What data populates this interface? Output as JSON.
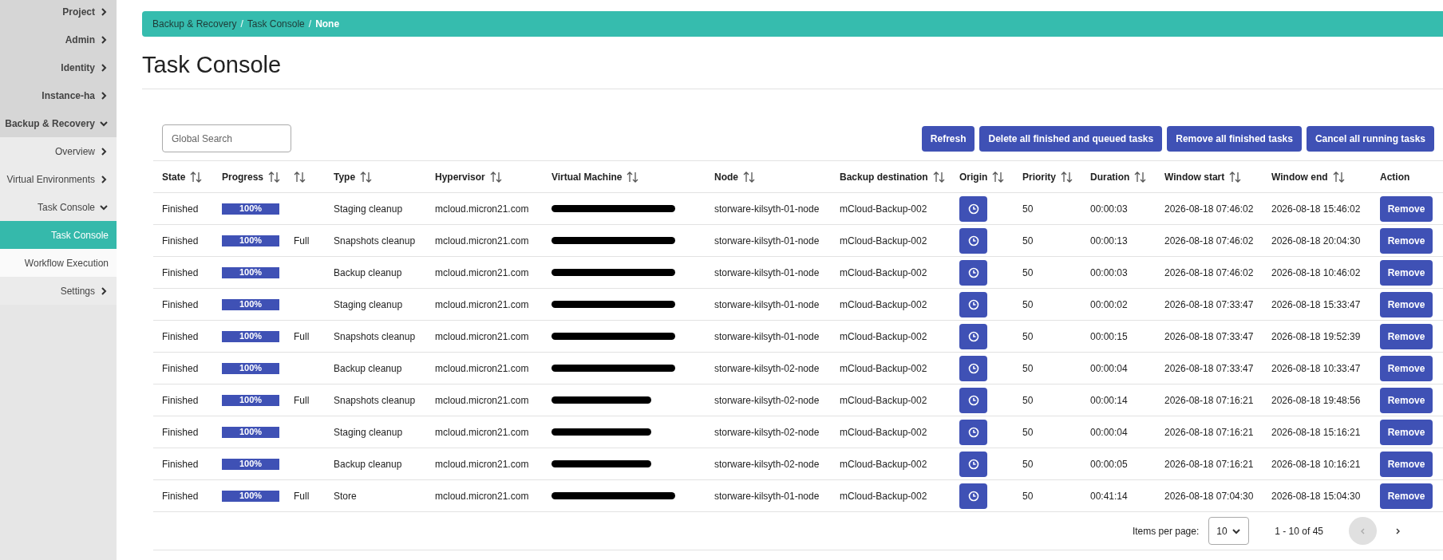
{
  "sidebar": {
    "items": [
      {
        "label": "Project",
        "expanded": false
      },
      {
        "label": "Admin",
        "expanded": false
      },
      {
        "label": "Identity",
        "expanded": false
      },
      {
        "label": "Instance-ha",
        "expanded": false
      },
      {
        "label": "Backup & Recovery",
        "expanded": true,
        "children": [
          {
            "label": "Overview",
            "expanded": false
          },
          {
            "label": "Virtual Environments",
            "expanded": false
          },
          {
            "label": "Task Console",
            "expanded": true,
            "children": [
              {
                "label": "Task Console",
                "selected": true
              },
              {
                "label": "Workflow Execution",
                "selected": false
              }
            ]
          },
          {
            "label": "Settings",
            "expanded": false
          }
        ]
      }
    ]
  },
  "breadcrumb": {
    "separator": "/",
    "items": [
      "Backup & Recovery",
      "Task Console",
      "None"
    ]
  },
  "title": "Task Console",
  "search": {
    "placeholder": "Global Search"
  },
  "buttons": [
    "Refresh",
    "Delete all finished and queued tasks",
    "Remove all finished tasks",
    "Cancel all running tasks"
  ],
  "table": {
    "columns": [
      {
        "label": "State",
        "sortable": true
      },
      {
        "label": "Progress",
        "sortable": true
      },
      {
        "sortable": true
      },
      {
        "label": "Type",
        "sortable": true
      },
      {
        "label": "Hypervisor",
        "sortable": true
      },
      {
        "label": "Virtual Machine",
        "sortable": true
      },
      {
        "label": "Node",
        "sortable": true
      },
      {
        "label": "Backup destination",
        "sortable": true
      },
      {
        "label": "Origin",
        "sortable": true
      },
      {
        "label": "Priority",
        "sortable": true
      },
      {
        "label": "Duration",
        "sortable": true
      },
      {
        "label": "Window start",
        "sortable": true
      },
      {
        "label": "Window end",
        "sortable": true
      },
      {
        "label": "Action",
        "sortable": false
      }
    ],
    "rows": [
      {
        "state": "Finished",
        "progress": {
          "level": 1,
          "label": "100%"
        },
        "mode": "",
        "type": "Staging cleanup",
        "hypervisor": "mcloud.micron21.com",
        "vm_redacted": true,
        "node": "storware-kilsyth-01-node",
        "destination": "mCloud-Backup-002",
        "priority": "50",
        "duration": "00:00:03",
        "window_start": "2026-08-18 07:46:02",
        "window_end": "2026-08-18 15:46:02",
        "action": "Remove"
      },
      {
        "state": "Finished",
        "progress": {
          "level": 1,
          "label": "100%"
        },
        "mode": "Full",
        "type": "Snapshots cleanup",
        "hypervisor": "mcloud.micron21.com",
        "vm_redacted": true,
        "node": "storware-kilsyth-01-node",
        "destination": "mCloud-Backup-002",
        "priority": "50",
        "duration": "00:00:13",
        "window_start": "2026-08-18 07:46:02",
        "window_end": "2026-08-18 20:04:30",
        "action": "Remove"
      },
      {
        "state": "Finished",
        "progress": {
          "level": 1,
          "label": "100%"
        },
        "mode": "",
        "type": "Backup cleanup",
        "hypervisor": "mcloud.micron21.com",
        "vm_redacted": true,
        "node": "storware-kilsyth-01-node",
        "destination": "mCloud-Backup-002",
        "priority": "50",
        "duration": "00:00:03",
        "window_start": "2026-08-18 07:46:02",
        "window_end": "2026-08-18 10:46:02",
        "action": "Remove"
      },
      {
        "state": "Finished",
        "progress": {
          "level": 1,
          "label": "100%"
        },
        "mode": "",
        "type": "Staging cleanup",
        "hypervisor": "mcloud.micron21.com",
        "vm_redacted": true,
        "node": "storware-kilsyth-01-node",
        "destination": "mCloud-Backup-002",
        "priority": "50",
        "duration": "00:00:02",
        "window_start": "2026-08-18 07:33:47",
        "window_end": "2026-08-18 15:33:47",
        "action": "Remove"
      },
      {
        "state": "Finished",
        "progress": {
          "level": 1,
          "label": "100%"
        },
        "mode": "Full",
        "type": "Snapshots cleanup",
        "hypervisor": "mcloud.micron21.com",
        "vm_redacted": true,
        "node": "storware-kilsyth-01-node",
        "destination": "mCloud-Backup-002",
        "priority": "50",
        "duration": "00:00:15",
        "window_start": "2026-08-18 07:33:47",
        "window_end": "2026-08-18 19:52:39",
        "action": "Remove"
      },
      {
        "state": "Finished",
        "progress": {
          "level": 1,
          "label": "100%"
        },
        "mode": "",
        "type": "Backup cleanup",
        "hypervisor": "mcloud.micron21.com",
        "vm_redacted": true,
        "node": "storware-kilsyth-02-node",
        "destination": "mCloud-Backup-002",
        "priority": "50",
        "duration": "00:00:04",
        "window_start": "2026-08-18 07:33:47",
        "window_end": "2026-08-18 10:33:47",
        "action": "Remove"
      },
      {
        "state": "Finished",
        "progress": {
          "level": 1,
          "label": "100%"
        },
        "mode": "Full",
        "type": "Snapshots cleanup",
        "hypervisor": "mcloud.micron21.com",
        "vm_redacted": true,
        "node": "storware-kilsyth-02-node",
        "destination": "mCloud-Backup-002",
        "priority": "50",
        "duration": "00:00:14",
        "window_start": "2026-08-18 07:16:21",
        "window_end": "2026-08-18 19:48:56",
        "action": "Remove"
      },
      {
        "state": "Finished",
        "progress": {
          "level": 1,
          "label": "100%"
        },
        "mode": "",
        "type": "Staging cleanup",
        "hypervisor": "mcloud.micron21.com",
        "vm_redacted": true,
        "node": "storware-kilsyth-02-node",
        "destination": "mCloud-Backup-002",
        "priority": "50",
        "duration": "00:00:04",
        "window_start": "2026-08-18 07:16:21",
        "window_end": "2026-08-18 15:16:21",
        "action": "Remove"
      },
      {
        "state": "Finished",
        "progress": {
          "level": 1,
          "label": "100%"
        },
        "mode": "",
        "type": "Backup cleanup",
        "hypervisor": "mcloud.micron21.com",
        "vm_redacted": true,
        "node": "storware-kilsyth-02-node",
        "destination": "mCloud-Backup-002",
        "priority": "50",
        "duration": "00:00:05",
        "window_start": "2026-08-18 07:16:21",
        "window_end": "2026-08-18 10:16:21",
        "action": "Remove"
      },
      {
        "state": "Finished",
        "progress": {
          "level": 1,
          "label": "100%"
        },
        "mode": "Full",
        "type": "Store",
        "hypervisor": "mcloud.micron21.com",
        "vm_redacted": true,
        "node": "storware-kilsyth-01-node",
        "destination": "mCloud-Backup-002",
        "priority": "50",
        "duration": "00:41:14",
        "window_start": "2026-08-18 07:04:30",
        "window_end": "2026-08-18 15:04:30",
        "action": "Remove"
      }
    ]
  },
  "pagination": {
    "label": "Items per page:",
    "page_size": "10",
    "range": "1 - 10 of 45",
    "prev_disabled": true,
    "next_disabled": false
  }
}
